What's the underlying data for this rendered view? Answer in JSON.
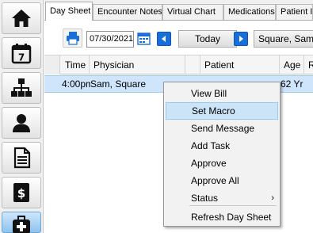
{
  "sidebar": {
    "items": [
      {
        "icon": "home-icon"
      },
      {
        "icon": "calendar-icon",
        "label": "7"
      },
      {
        "icon": "org-chart-icon"
      },
      {
        "icon": "user-icon"
      },
      {
        "icon": "document-icon"
      },
      {
        "icon": "dollar-icon",
        "label": "$"
      },
      {
        "icon": "medical-bag-icon"
      }
    ]
  },
  "tabs": [
    "Day Sheet",
    "Encounter Notes",
    "Virtual Chart",
    "Medications",
    "Patient In"
  ],
  "toolbar": {
    "date_value": "07/30/2021",
    "today_label": "Today",
    "provider_value": "Square, Sam ["
  },
  "grid": {
    "headers": [
      "Time",
      "Physician",
      "Patient",
      "Age",
      "R"
    ],
    "rows": [
      {
        "time": "4:00pm",
        "physician": "Sam, Square",
        "age": "62 Yr"
      }
    ]
  },
  "context_menu": {
    "items": [
      "View Bill",
      "Set Macro",
      "Send Message",
      "Add Task",
      "Approve",
      "Approve All",
      "Status",
      "Refresh Day Sheet"
    ],
    "highlighted": "Set Macro",
    "submenu_arrow": "›"
  },
  "colors": {
    "selection_blue": "#cfe5fb",
    "menu_highlight": "#cce4f7",
    "nav_button_blue": "#1a6ed8"
  }
}
